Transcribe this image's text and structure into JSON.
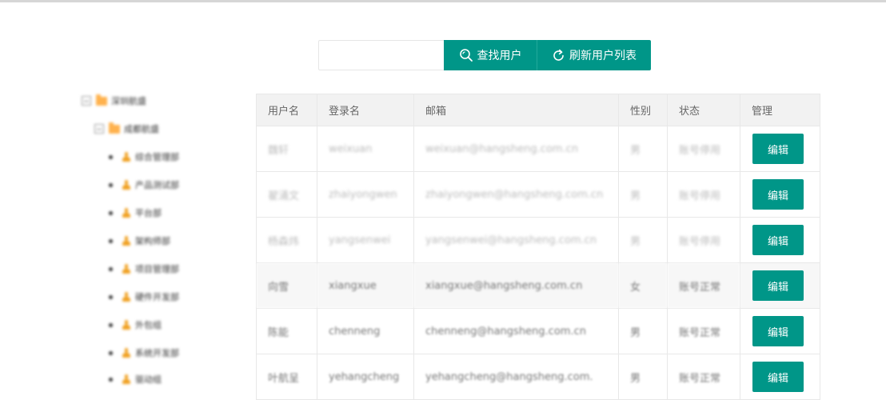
{
  "search": {
    "value": "",
    "placeholder": "",
    "find_label": "查找用户",
    "refresh_label": "刷新用户列表"
  },
  "tree": [
    {
      "type": "folder",
      "label": "深圳航盛"
    },
    {
      "type": "folder",
      "label": "成都航盛"
    },
    {
      "type": "dept",
      "label": "综合管理部"
    },
    {
      "type": "dept",
      "label": "产品测试部"
    },
    {
      "type": "dept",
      "label": "平台部"
    },
    {
      "type": "dept",
      "label": "架构师部"
    },
    {
      "type": "dept",
      "label": "项目管理部"
    },
    {
      "type": "dept",
      "label": "硬件开发部"
    },
    {
      "type": "dept",
      "label": "外包组"
    },
    {
      "type": "dept",
      "label": "系统开发部"
    },
    {
      "type": "dept",
      "label": "驱动组"
    }
  ],
  "table": {
    "headers": {
      "username": "用户名",
      "login": "登录名",
      "email": "邮箱",
      "gender": "性别",
      "status": "状态",
      "manage": "管理"
    },
    "edit_label": "编辑",
    "rows": [
      {
        "username": "魏轩",
        "login": "weixuan",
        "email": "weixuan@hangsheng.com.cn",
        "gender": "男",
        "status": "账号停用"
      },
      {
        "username": "翟涌文",
        "login": "zhaiyongwen",
        "email": "zhaiyongwen@hangsheng.com.cn",
        "gender": "男",
        "status": "账号停用"
      },
      {
        "username": "杨森炜",
        "login": "yangsenwei",
        "email": "yangsenwei@hangsheng.com.cn",
        "gender": "男",
        "status": "账号停用"
      },
      {
        "username": "向雪",
        "login": "xiangxue",
        "email": "xiangxue@hangsheng.com.cn",
        "gender": "女",
        "status": "账号正常"
      },
      {
        "username": "陈能",
        "login": "chenneng",
        "email": "chenneng@hangsheng.com.cn",
        "gender": "男",
        "status": "账号正常"
      },
      {
        "username": "叶航呈",
        "login": "yehangcheng",
        "email": "yehangcheng@hangsheng.com.",
        "gender": "男",
        "status": "账号正常"
      }
    ]
  },
  "colors": {
    "accent": "#009688",
    "folder": "#ffb24d"
  }
}
